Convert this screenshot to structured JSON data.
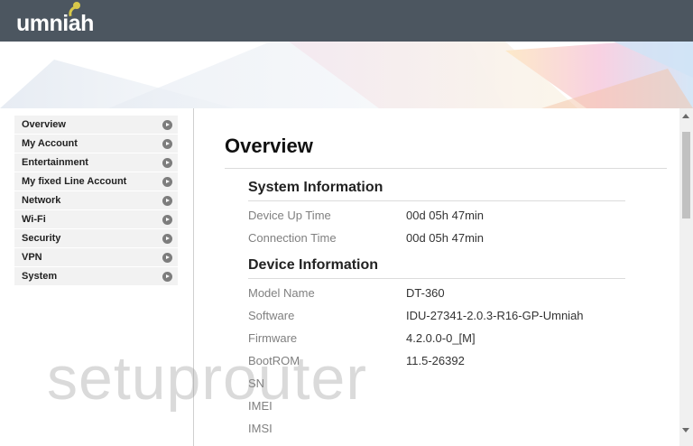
{
  "header": {
    "logo_text": "umniah",
    "accent_color": "#d8c84a",
    "bar_color": "#4c5660"
  },
  "sidebar": {
    "items": [
      {
        "label": "Overview"
      },
      {
        "label": "My Account"
      },
      {
        "label": "Entertainment"
      },
      {
        "label": "My fixed Line Account"
      },
      {
        "label": "Network"
      },
      {
        "label": "Wi-Fi"
      },
      {
        "label": "Security"
      },
      {
        "label": "VPN"
      },
      {
        "label": "System"
      }
    ],
    "item_icon": "chevron-right-circle-icon"
  },
  "main": {
    "title": "Overview",
    "system_information": {
      "heading": "System Information",
      "rows": [
        {
          "label": "Device Up Time",
          "value": "00d 05h 47min"
        },
        {
          "label": "Connection Time",
          "value": "00d 05h 47min"
        }
      ]
    },
    "device_information": {
      "heading": "Device Information",
      "rows": [
        {
          "label": "Model Name",
          "value": "DT-360"
        },
        {
          "label": "Software",
          "value": "IDU-27341-2.0.3-R16-GP-Umniah"
        },
        {
          "label": "Firmware",
          "value": "4.2.0.0-0_[M]"
        },
        {
          "label": "BootROM",
          "value": "11.5-26392"
        },
        {
          "label": "SN",
          "value": ""
        },
        {
          "label": "IMEI",
          "value": ""
        },
        {
          "label": "IMSI",
          "value": ""
        }
      ]
    }
  },
  "watermark": "setuprouter"
}
